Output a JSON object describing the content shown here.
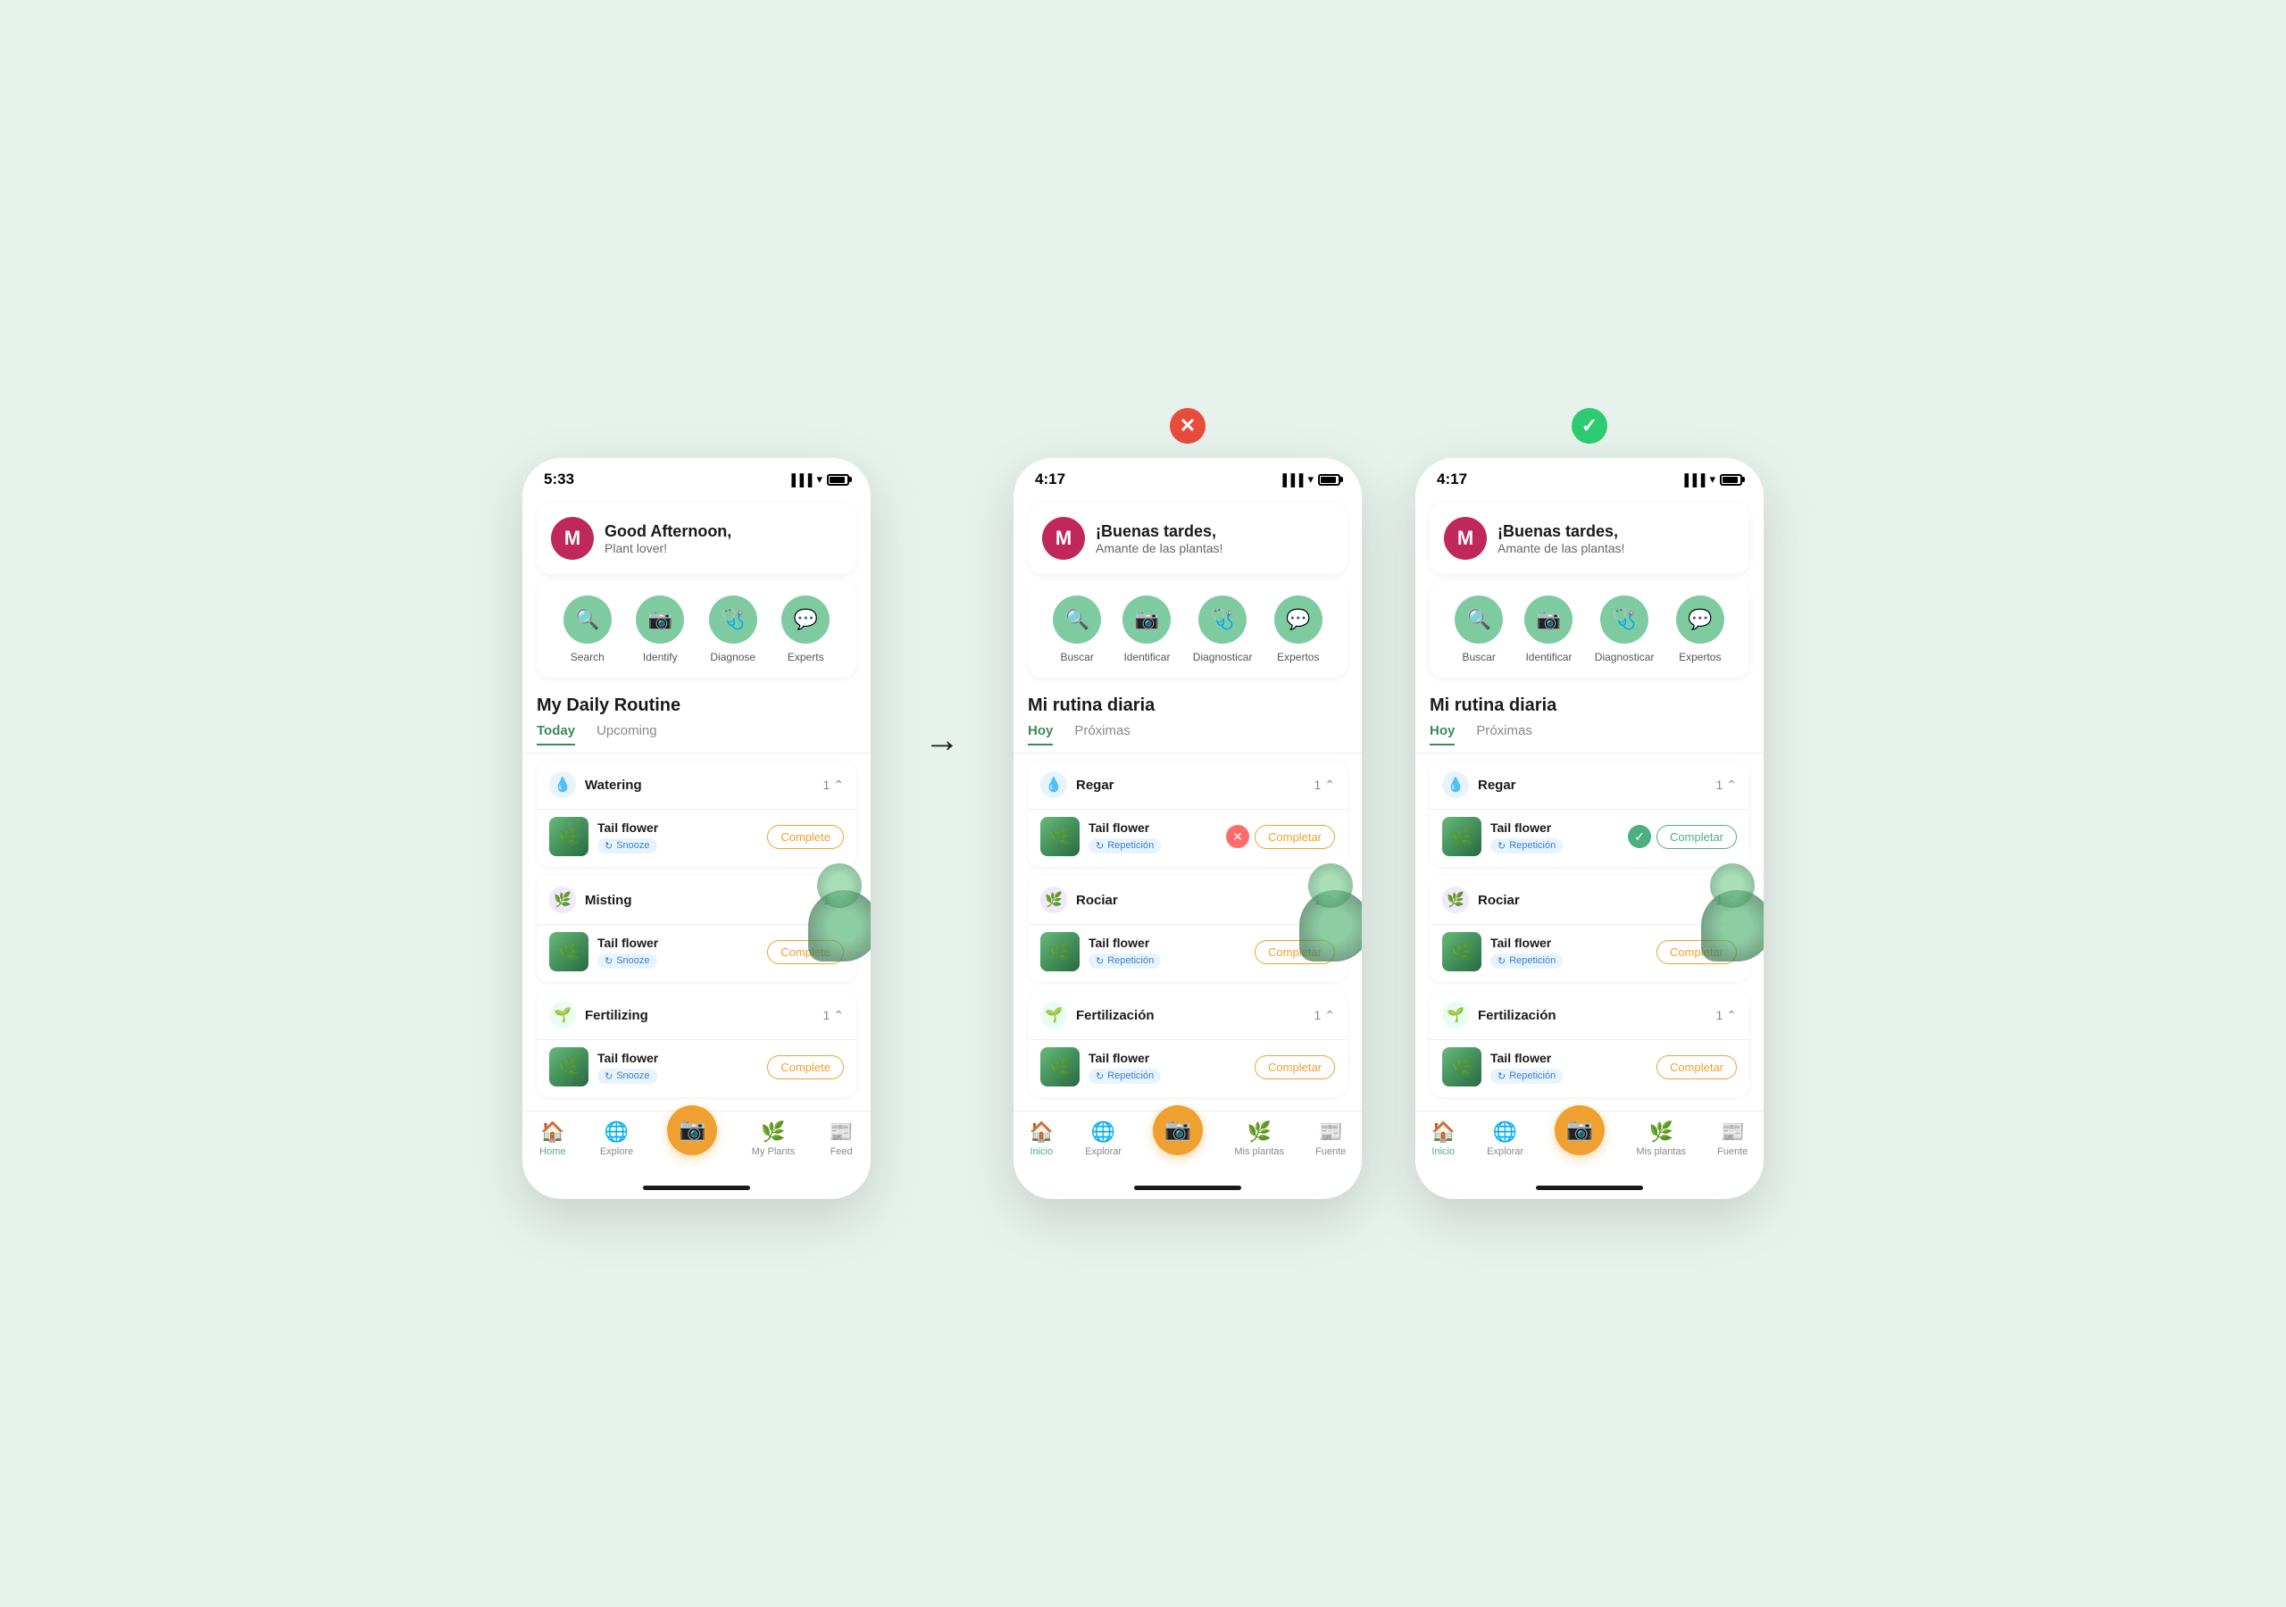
{
  "phones": [
    {
      "id": "phone1",
      "badge": null,
      "status_time": "5:33",
      "greeting_title": "Good Afternoon,",
      "greeting_sub": "Plant lover!",
      "avatar_letter": "M",
      "actions": [
        {
          "icon": "🔍",
          "label": "Search"
        },
        {
          "icon": "📷",
          "label": "Identify"
        },
        {
          "icon": "🩺",
          "label": "Diagnose"
        },
        {
          "icon": "💬",
          "label": "Experts"
        }
      ],
      "routine_title": "My Daily Routine",
      "tabs": [
        {
          "label": "Today",
          "active": true
        },
        {
          "label": "Upcoming",
          "active": false
        }
      ],
      "categories": [
        {
          "name": "Watering",
          "icon_type": "water",
          "icon": "💧",
          "count": "1",
          "plant": "Tail flower",
          "badge_text": "Snooze",
          "complete_text": "Complete",
          "complete_type": "orange"
        },
        {
          "name": "Misting",
          "icon_type": "mist",
          "icon": "🌿",
          "count": "1",
          "plant": "Tail flower",
          "badge_text": "Snooze",
          "complete_text": "Complete",
          "complete_type": "orange"
        },
        {
          "name": "Fertilizing",
          "icon_type": "fert",
          "icon": "🌱",
          "count": "1",
          "plant": "Tail flower",
          "badge_text": "Snooze",
          "complete_text": "Complete",
          "complete_type": "orange"
        }
      ],
      "nav": [
        {
          "icon": "🏠",
          "label": "Home",
          "active": true
        },
        {
          "icon": "🌐",
          "label": "Explore",
          "active": false
        },
        {
          "icon": "📷",
          "label": "",
          "active": false,
          "is_fab": true
        },
        {
          "icon": "🌿",
          "label": "My Plants",
          "active": false
        },
        {
          "icon": "📰",
          "label": "Feed",
          "active": false
        }
      ]
    },
    {
      "id": "phone2",
      "badge": "x",
      "status_time": "4:17",
      "greeting_title": "¡Buenas tardes,",
      "greeting_sub": "Amante de las plantas!",
      "avatar_letter": "M",
      "actions": [
        {
          "icon": "🔍",
          "label": "Buscar"
        },
        {
          "icon": "📷",
          "label": "Identificar"
        },
        {
          "icon": "🩺",
          "label": "Diagnosticar"
        },
        {
          "icon": "💬",
          "label": "Expertos"
        }
      ],
      "routine_title": "Mi rutina diaria",
      "tabs": [
        {
          "label": "Hoy",
          "active": true
        },
        {
          "label": "Próximas",
          "active": false
        }
      ],
      "categories": [
        {
          "name": "Regar",
          "icon_type": "water",
          "icon": "💧",
          "count": "1",
          "plant": "Tail flower",
          "badge_text": "Repetición",
          "complete_text": "Completar",
          "complete_type": "x-orange"
        },
        {
          "name": "Rociar",
          "icon_type": "mist",
          "icon": "🌿",
          "count": "1",
          "plant": "Tail flower",
          "badge_text": "Repetición",
          "complete_text": "Completar",
          "complete_type": "orange"
        },
        {
          "name": "Fertilización",
          "icon_type": "fert",
          "icon": "🌱",
          "count": "1",
          "plant": "Tail flower",
          "badge_text": "Repetición",
          "complete_text": "Completar",
          "complete_type": "orange"
        }
      ],
      "nav": [
        {
          "icon": "🏠",
          "label": "Inicio",
          "active": true
        },
        {
          "icon": "🌐",
          "label": "Explorar",
          "active": false
        },
        {
          "icon": "📷",
          "label": "",
          "active": false,
          "is_fab": true
        },
        {
          "icon": "🌿",
          "label": "Mis plantas",
          "active": false
        },
        {
          "icon": "📰",
          "label": "Fuente",
          "active": false
        }
      ]
    },
    {
      "id": "phone3",
      "badge": "check",
      "status_time": "4:17",
      "greeting_title": "¡Buenas tardes,",
      "greeting_sub": "Amante de las plantas!",
      "avatar_letter": "M",
      "actions": [
        {
          "icon": "🔍",
          "label": "Buscar"
        },
        {
          "icon": "📷",
          "label": "Identificar"
        },
        {
          "icon": "🩺",
          "label": "Diagnosticar"
        },
        {
          "icon": "💬",
          "label": "Expertos"
        }
      ],
      "routine_title": "Mi rutina diaria",
      "tabs": [
        {
          "label": "Hoy",
          "active": true
        },
        {
          "label": "Próximas",
          "active": false
        }
      ],
      "categories": [
        {
          "name": "Regar",
          "icon_type": "water",
          "icon": "💧",
          "count": "1",
          "plant": "Tail flower",
          "badge_text": "Repetición",
          "complete_text": "Completar",
          "complete_type": "green-check"
        },
        {
          "name": "Rociar",
          "icon_type": "mist",
          "icon": "🌿",
          "count": "1",
          "plant": "Tail flower",
          "badge_text": "Repetición",
          "complete_text": "Completar",
          "complete_type": "orange"
        },
        {
          "name": "Fertilización",
          "icon_type": "fert",
          "icon": "🌱",
          "count": "1",
          "plant": "Tail flower",
          "badge_text": "Repetición",
          "complete_text": "Completar",
          "complete_type": "orange"
        }
      ],
      "nav": [
        {
          "icon": "🏠",
          "label": "Inicio",
          "active": true
        },
        {
          "icon": "🌐",
          "label": "Explorar",
          "active": false
        },
        {
          "icon": "📷",
          "label": "",
          "active": false,
          "is_fab": true
        },
        {
          "icon": "🌿",
          "label": "Mis plantas",
          "active": false
        },
        {
          "icon": "📰",
          "label": "Fuente",
          "active": false
        }
      ]
    }
  ],
  "arrow_symbol": "→",
  "colors": {
    "green_active": "#4caf82",
    "orange": "#f0a030",
    "red": "#e74c3c",
    "water_bg": "#e8f4fd",
    "water_color": "#3a7bd5",
    "mist_bg": "#f0e8fd",
    "mist_color": "#8a3bd5",
    "fert_bg": "#e8fdf0",
    "fert_color": "#3ab55a"
  }
}
